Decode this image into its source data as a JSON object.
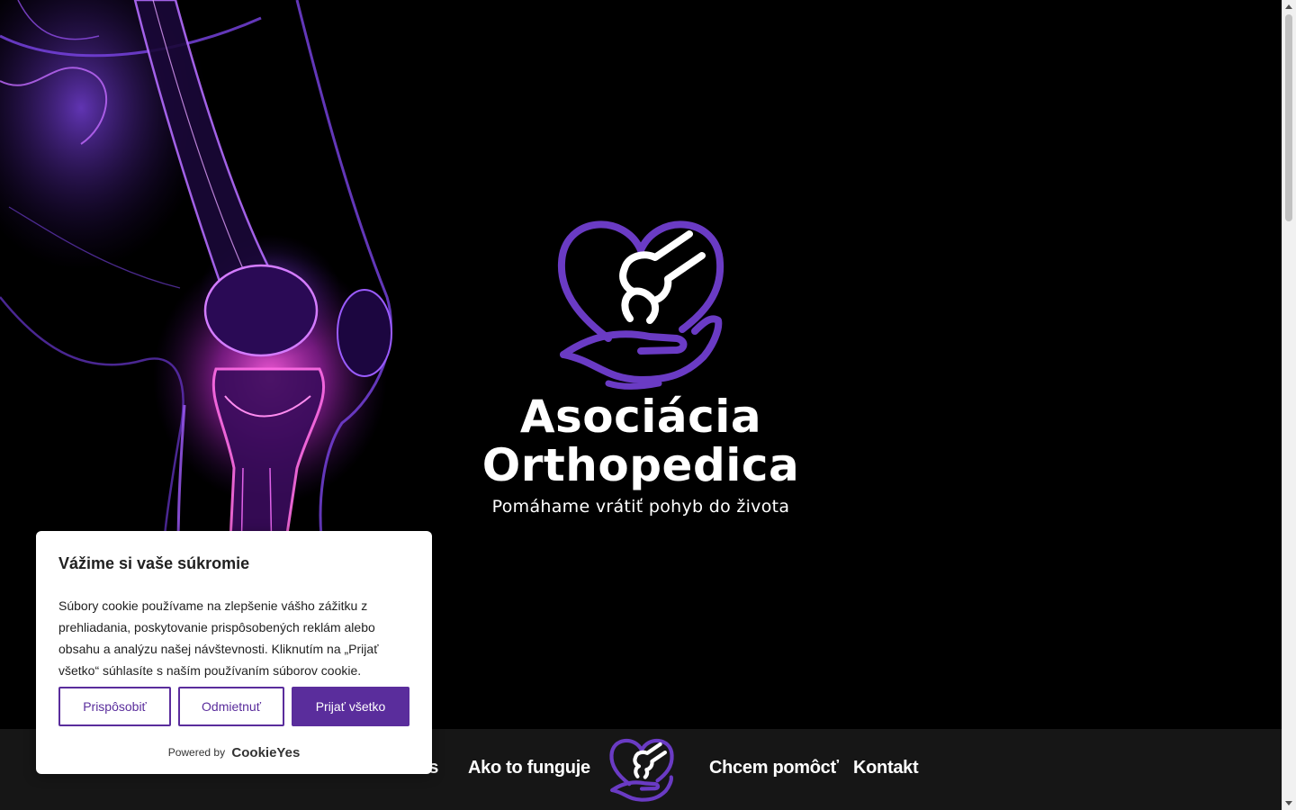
{
  "hero": {
    "title_line1": "Asociácia",
    "title_line2": "Orthopedica",
    "tagline": "Pomáhame vrátiť pohyb do života",
    "logo_icon": "heart-hand-joint-icon",
    "art_icon": "knee-xray-illustration"
  },
  "nav": {
    "items": [
      {
        "label": "O nás"
      },
      {
        "label": "Ako to funguje"
      },
      {
        "label": "Chcem pomôcť"
      },
      {
        "label": "Kontakt"
      }
    ],
    "logo_icon": "heart-hand-joint-icon"
  },
  "cookie": {
    "title": "Vážime si vaše súkromie",
    "text": "Súbory cookie používame na zlepšenie vášho zážitku z prehliadania, poskytovanie prispôsobených reklám alebo obsahu a analýzu našej návštevnosti. Kliknutím na „Prijať všetko“ súhlasíte s naším používaním súborov cookie.",
    "customize_label": "Prispôsobiť",
    "reject_label": "Odmietnuť",
    "accept_label": "Prijať všetko",
    "powered_by": "Powered by",
    "brand": "CookieYes"
  },
  "colors": {
    "accent": "#5a2d9c",
    "logo_purple": "#6a3bc4",
    "background": "#000000",
    "navbar": "#161616"
  }
}
